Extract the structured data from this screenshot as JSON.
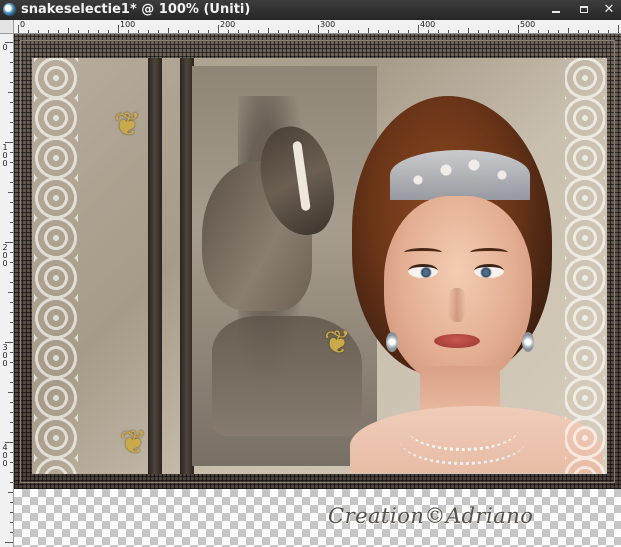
{
  "window": {
    "title": "snakeselectie1* @ 100% (Uniti)",
    "app_icon": "paint-program-icon",
    "controls": {
      "minimize_icon": "minimize-icon",
      "maximize_icon": "maximize-icon",
      "close_icon": "close-icon",
      "close_glyph": "✕"
    }
  },
  "ruler": {
    "top_labels": [
      "0",
      "100",
      "200",
      "300",
      "400",
      "500"
    ],
    "left_labels": [
      "0",
      "100",
      "200",
      "300",
      "400"
    ]
  },
  "canvas": {
    "signature": "Creation©Adriano",
    "decorations": {
      "butterfly_glyph": "❦",
      "butterfly_icon": "butterfly-icon"
    }
  },
  "colors": {
    "titlebar": "#2f2f2f",
    "frame": "#3a332d",
    "sepia_background": "#b8ad9d",
    "checker_light": "#ffffff",
    "checker_dark": "#c6c6c6"
  }
}
